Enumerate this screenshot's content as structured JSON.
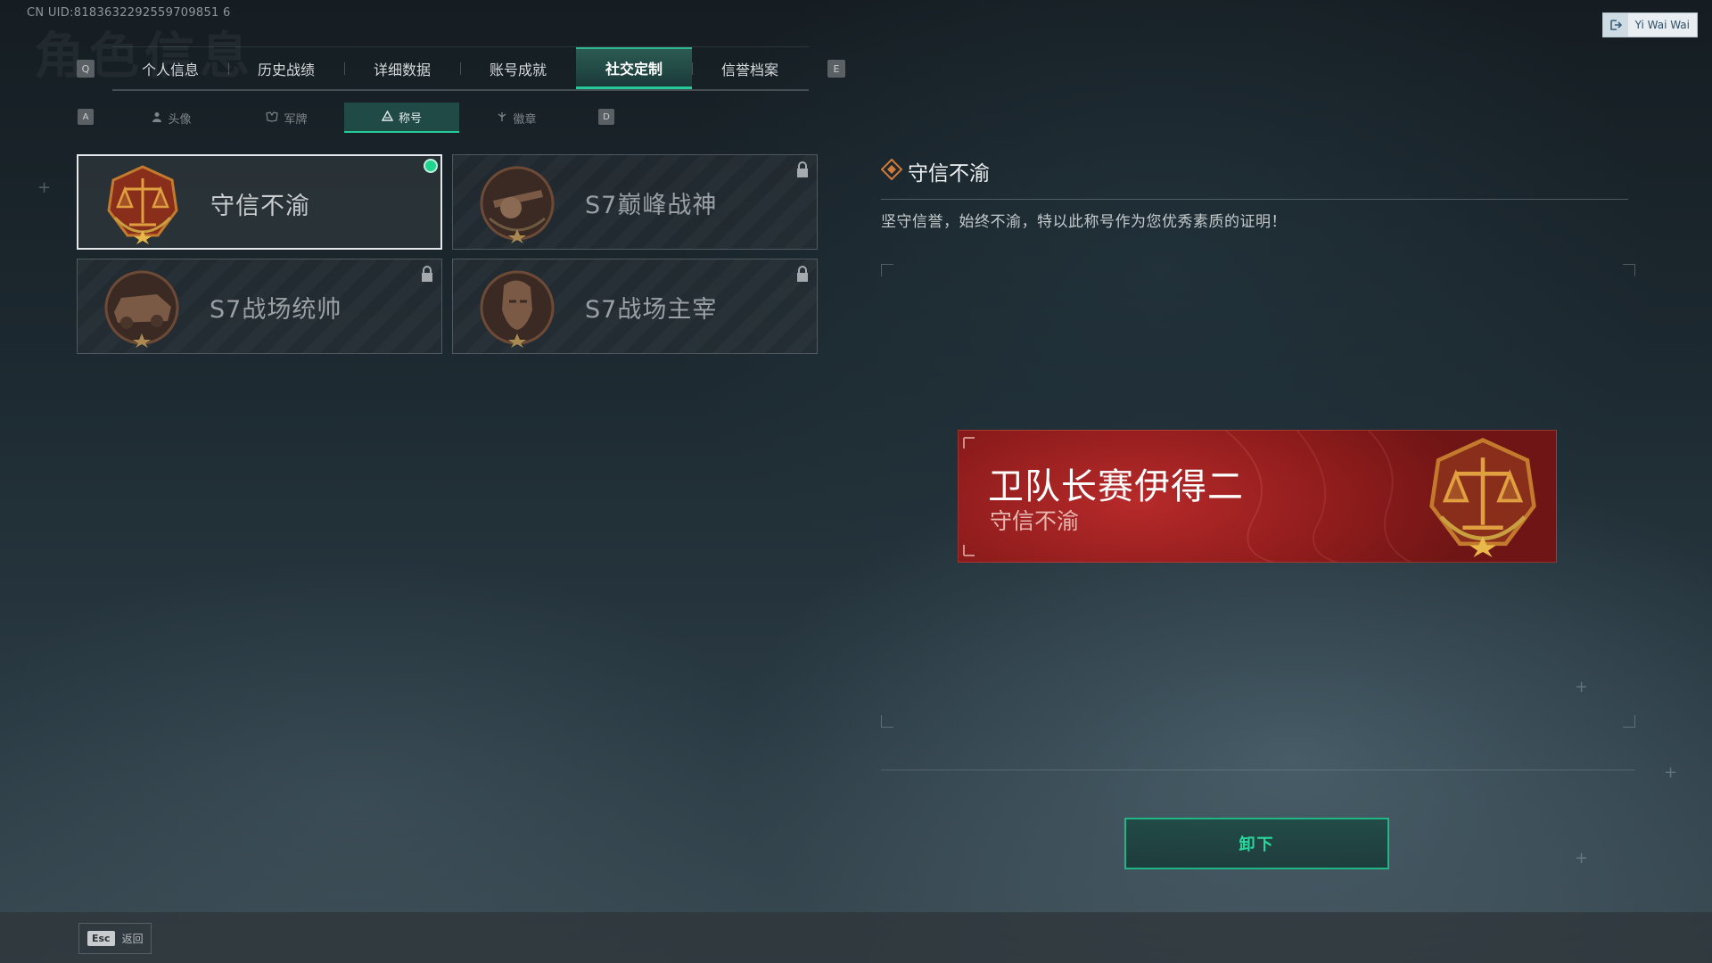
{
  "uid": "CN UID:8183632292559709851 6",
  "bg_title": "角色信息",
  "user": {
    "name": "Yi Wai Wai",
    "icon": "logout-icon"
  },
  "main_tabs": {
    "prev_key": "Q",
    "next_key": "E",
    "items": [
      {
        "label": "个人信息"
      },
      {
        "label": "历史战绩"
      },
      {
        "label": "详细数据"
      },
      {
        "label": "账号成就"
      },
      {
        "label": "社交定制",
        "active": true
      },
      {
        "label": "信誉档案"
      }
    ]
  },
  "sub_tabs": {
    "prev_key": "A",
    "next_key": "D",
    "items": [
      {
        "label": "头像",
        "icon": "person-icon"
      },
      {
        "label": "军牌",
        "icon": "dogtag-icon"
      },
      {
        "label": "称号",
        "icon": "title-icon",
        "active": true
      },
      {
        "label": "徽章",
        "icon": "badge-icon"
      }
    ]
  },
  "titles": [
    {
      "name": "守信不渝",
      "selected": true,
      "equipped": true,
      "locked": false,
      "emblem": "scales-emblem-icon"
    },
    {
      "name": "S7巅峰战神",
      "selected": false,
      "locked": true,
      "emblem": "gunner-emblem-icon"
    },
    {
      "name": "S7战场统帅",
      "selected": false,
      "locked": true,
      "emblem": "vehicle-emblem-icon"
    },
    {
      "name": "S7战场主宰",
      "selected": false,
      "locked": true,
      "emblem": "soldier-emblem-icon"
    }
  ],
  "detail": {
    "title": "守信不渝",
    "description": "坚守信誉，始终不渝，特以此称号作为您优秀素质的证明！"
  },
  "preview": {
    "player_name": "卫队长赛伊得二",
    "title": "守信不渝"
  },
  "unequip_label": "卸下",
  "footer": {
    "esc_key": "Esc",
    "back_label": "返回"
  },
  "colors": {
    "accent": "#26c99a",
    "banner_red": "#9a2020",
    "emblem_bronze": "#c47a2c"
  }
}
